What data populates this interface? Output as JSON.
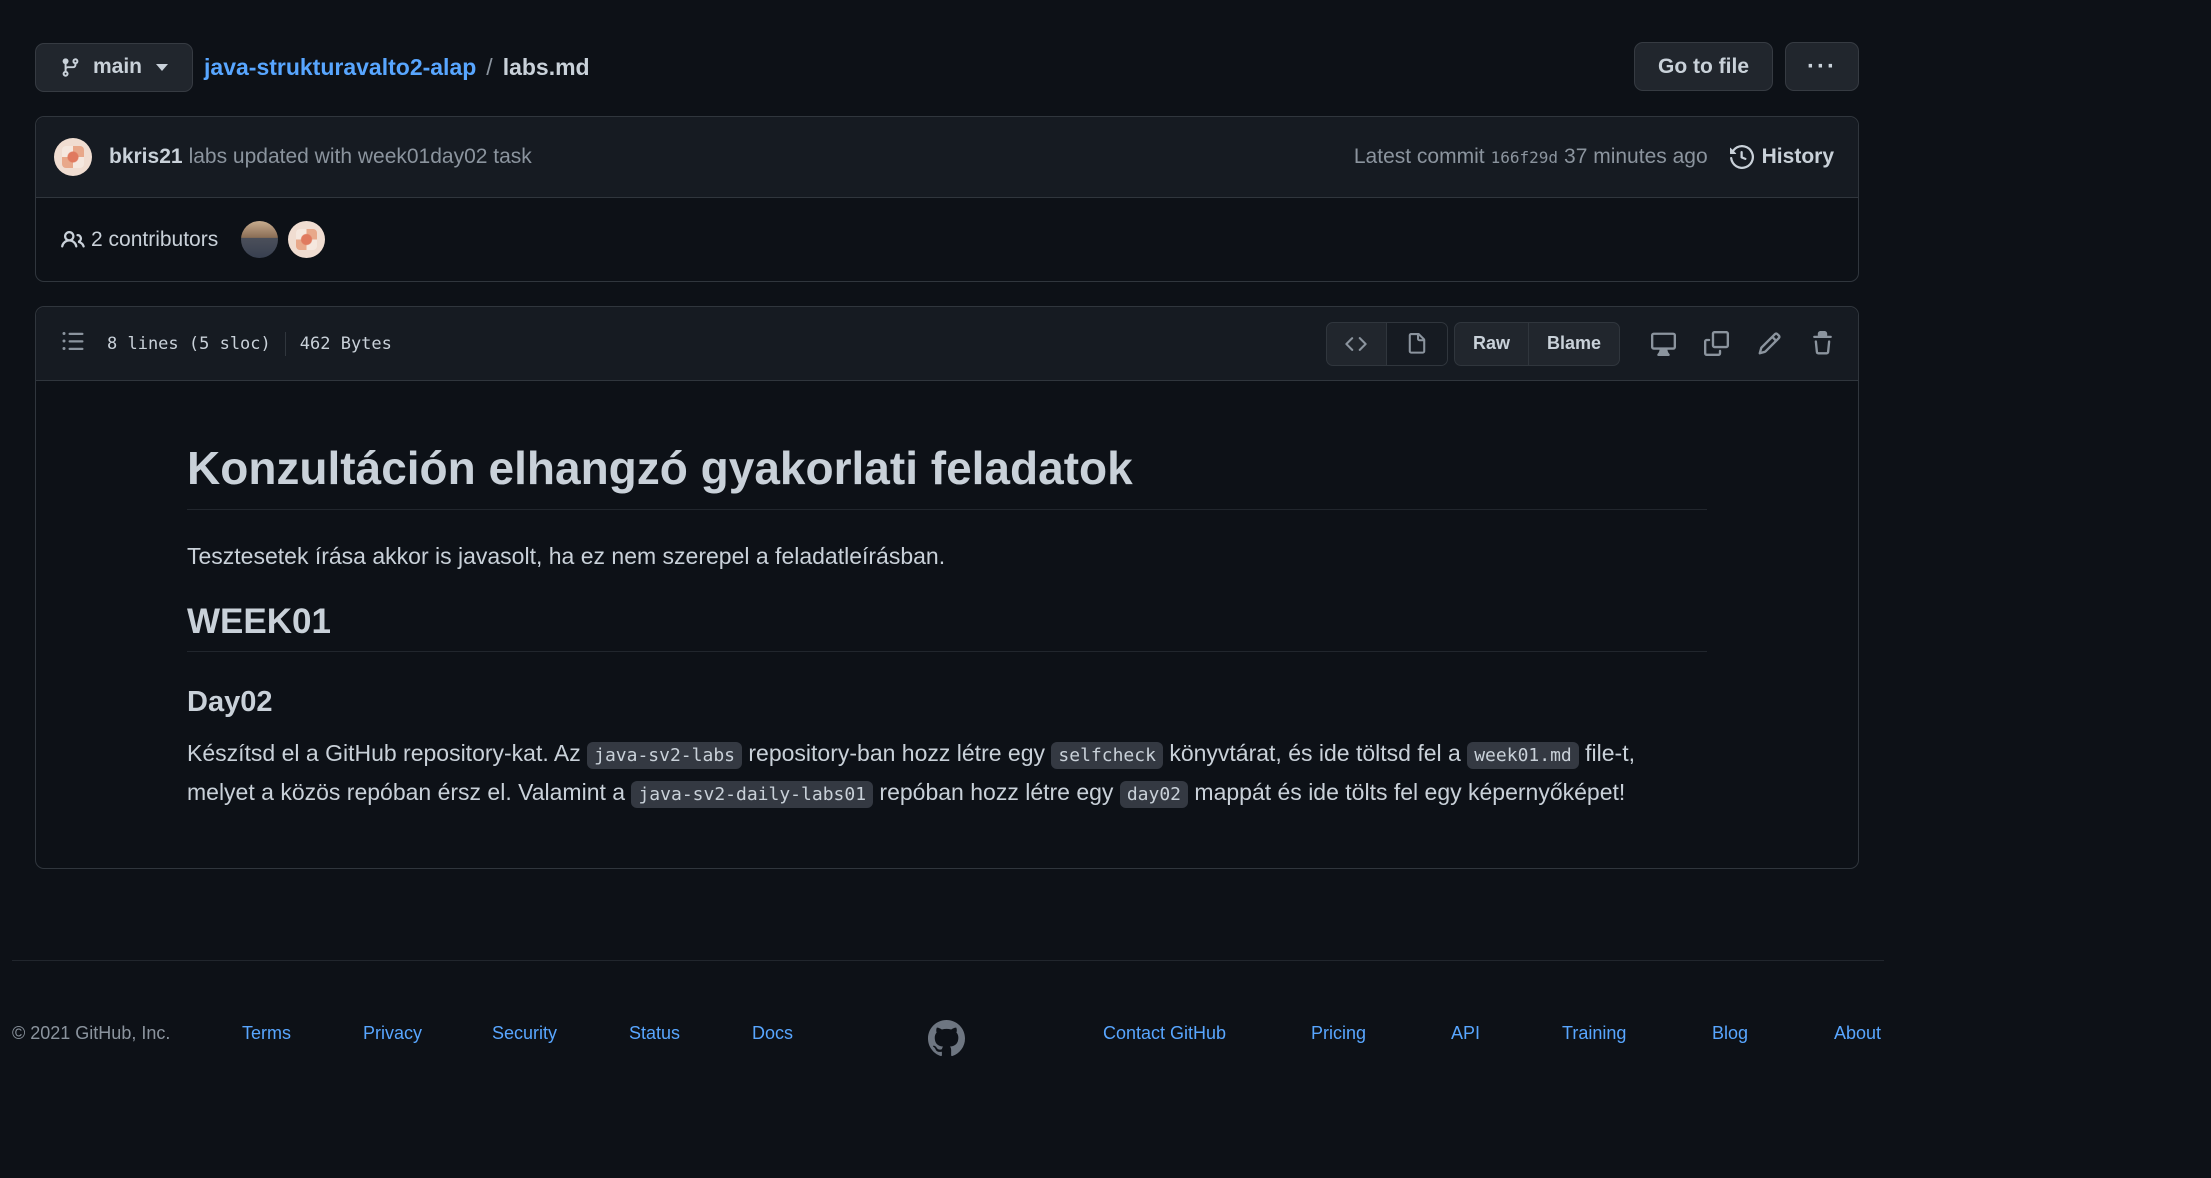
{
  "header": {
    "branch": "main",
    "repo": "java-strukturavalto2-alap",
    "separator": "/",
    "file": "labs.md",
    "go_to_file": "Go to file",
    "more": "···"
  },
  "commit": {
    "author": "bkris21",
    "message": "labs updated with week01day02 task",
    "latest_label": "Latest commit",
    "sha": "166f29d",
    "time": "37 minutes ago",
    "history": "History",
    "contributors": "2 contributors"
  },
  "file": {
    "lines": "8 lines (5 sloc)",
    "size": "462 Bytes",
    "raw": "Raw",
    "blame": "Blame"
  },
  "markdown": {
    "h1": "Konzultáción elhangzó gyakorlati feladatok",
    "intro": "Tesztesetek írása akkor is javasolt, ha ez nem szerepel a feladatleírásban.",
    "h2": "WEEK01",
    "h3": "Day02",
    "task": {
      "t1": "Készítsd el a GitHub repository-kat. Az ",
      "c1": "java-sv2-labs",
      "t2": " repository-ban hozz létre egy ",
      "c2": "selfcheck",
      "t3": " könyvtárat, és ide töltsd fel a ",
      "c3": "week01.md",
      "t4": " file-t, melyet a közös repóban érsz el. Valamint a ",
      "c4": "java-sv2-daily-labs01",
      "t5": " repóban hozz létre egy ",
      "c5": "day02",
      "t6": " mappát és ide tölts fel egy képernyőképet!"
    }
  },
  "footer": {
    "copyright": "© 2021 GitHub, Inc.",
    "terms": "Terms",
    "privacy": "Privacy",
    "security": "Security",
    "status": "Status",
    "docs": "Docs",
    "contact": "Contact GitHub",
    "pricing": "Pricing",
    "api": "API",
    "training": "Training",
    "blog": "Blog",
    "about": "About"
  },
  "colors": {
    "background": "#0d1117",
    "link": "#58a6ff",
    "text": "#c9d1d9",
    "muted": "#8b949e",
    "border": "#30363d"
  }
}
